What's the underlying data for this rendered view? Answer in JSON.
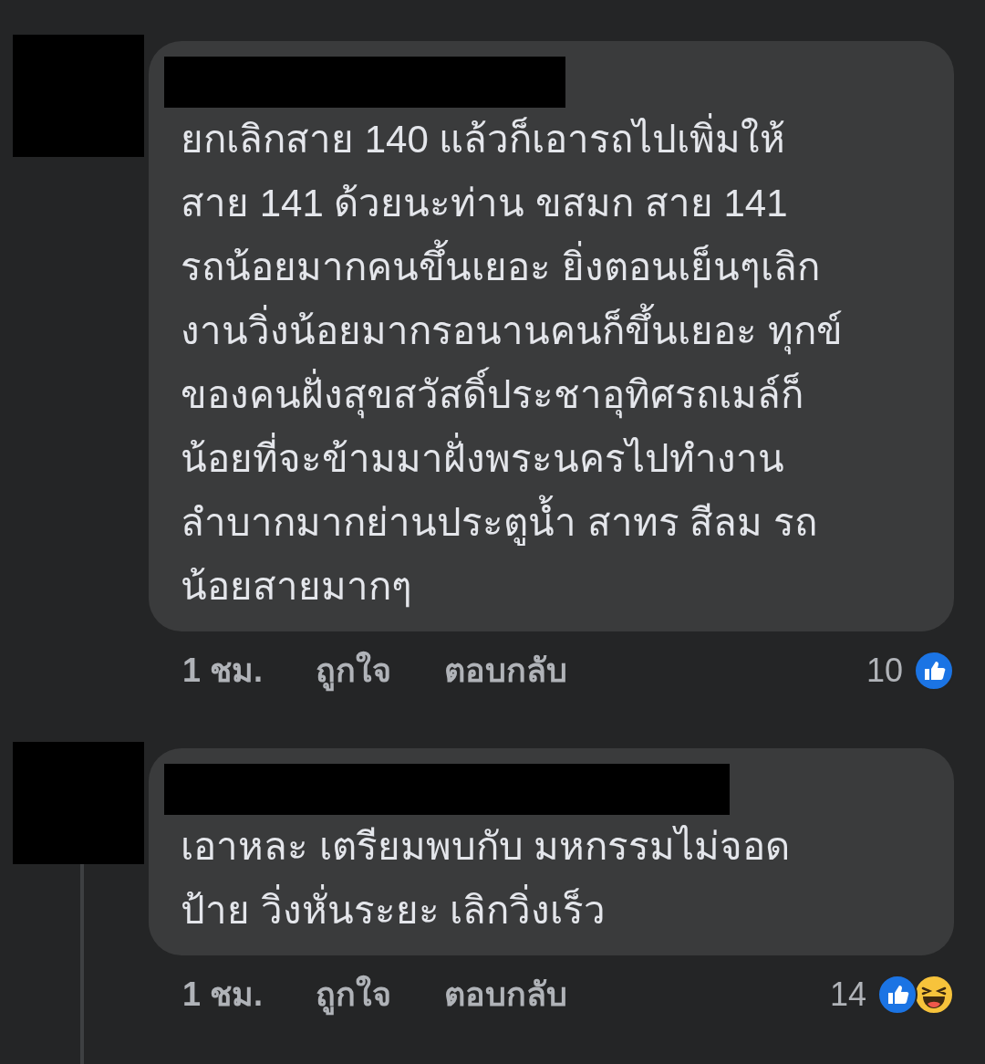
{
  "comments": [
    {
      "text_lines": [
        "ยกเลิกสาย 140 แล้วก็เอารถไปเพิ่มให้",
        "สาย 141 ด้วยนะท่าน ขสมก สาย 141",
        "รถน้อยมากคนขึ้นเยอะ ยิ่งตอนเย็นๆเลิก",
        "งานวิ่งน้อยมากรอนานคนก็ขึ้นเยอะ ทุกข์",
        "ของคนฝั่งสุขสวัสดิ์ประชาอุทิศรถเมล์ก็",
        "น้อยที่จะข้ามมาฝั่งพระนครไปทำงาน",
        "ลำบากมากย่านประตูน้ำ สาทร สีลม รถ",
        "น้อยสายมากๆ"
      ],
      "time": "1 ชม.",
      "like_label": "ถูกใจ",
      "reply_label": "ตอบกลับ",
      "reaction_count": "10",
      "reactions": [
        {
          "kind": "like"
        }
      ]
    },
    {
      "text_lines": [
        "เอาหละ เตรียมพบกับ มหกรรมไม่จอด",
        "ป้าย วิ่งหั่นระยะ เลิกวิ่งเร็ว"
      ],
      "time": "1 ชม.",
      "like_label": "ถูกใจ",
      "reply_label": "ตอบกลับ",
      "reaction_count": "14",
      "reactions": [
        {
          "kind": "like"
        },
        {
          "kind": "haha"
        }
      ]
    }
  ]
}
